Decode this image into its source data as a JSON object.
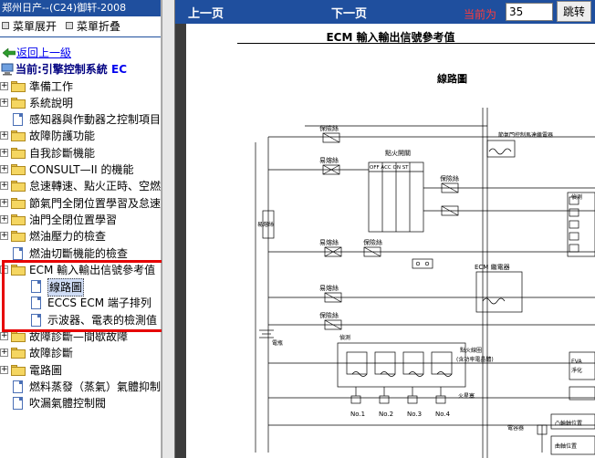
{
  "sidebar": {
    "title": "郑州日产--(C24)御轩-2008",
    "expand_all_label": "菜單展开",
    "collapse_all_label": "菜單折叠",
    "back_link": "返回上一級",
    "current_prefix": "当前:引擎控制系統",
    "current_suffix": "EC",
    "items": [
      {
        "label": "準備工作",
        "type": "folder",
        "expandable": true
      },
      {
        "label": "系統說明",
        "type": "folder",
        "expandable": true
      },
      {
        "label": "感知器與作動器之控制項目",
        "type": "doc",
        "expandable": false
      },
      {
        "label": "故障防護功能",
        "type": "folder",
        "expandable": true
      },
      {
        "label": "自我診斷機能",
        "type": "folder",
        "expandable": true
      },
      {
        "label": "CONSULT—II 的機能",
        "type": "folder",
        "expandable": true
      },
      {
        "label": "怠速轉速、點火正時、空燃",
        "type": "folder",
        "expandable": true
      },
      {
        "label": "節氣門全閉位置學習及怠速",
        "type": "folder",
        "expandable": true
      },
      {
        "label": "油門全閉位置學習",
        "type": "folder",
        "expandable": true
      },
      {
        "label": "燃油壓力的檢查",
        "type": "folder",
        "expandable": true
      },
      {
        "label": "燃油切斷機能的檢查",
        "type": "doc",
        "expandable": false
      },
      {
        "label": "ECM 輸入輸出信號參考值",
        "type": "folder-open",
        "expandable": true
      },
      {
        "label": "線路圖",
        "type": "doc",
        "child": true,
        "selected": true
      },
      {
        "label": "ECCS ECM 端子排列",
        "type": "doc",
        "child": true
      },
      {
        "label": "示波器、電表的檢測值",
        "type": "doc",
        "child": true
      },
      {
        "label": "故障診斷—間歇故障",
        "type": "folder",
        "expandable": true
      },
      {
        "label": "故障診斷",
        "type": "folder",
        "expandable": true
      },
      {
        "label": "電路圖",
        "type": "folder",
        "expandable": true
      },
      {
        "label": "燃料蒸發（蒸氣）氣體抑制",
        "type": "doc",
        "expandable": false
      },
      {
        "label": "吹漏氣體控制閥",
        "type": "doc",
        "expandable": false
      }
    ]
  },
  "toolbar": {
    "prev_label": "上一页",
    "next_label": "下一页",
    "current_page_label": "当前为",
    "page_value": "35",
    "go_label": "跳转"
  },
  "document": {
    "page_title": "ECM 輸入輸出信號參考值",
    "diagram_title": "線路圖",
    "labels": {
      "fuse": "保險絲",
      "fusible_link": "易熔絲",
      "ignition_switch": "點火開關",
      "switch_positions": [
        "OFF",
        "ACC",
        "ON",
        "ST"
      ],
      "main_relay": "ECM 繼電器",
      "throttle_motor_relay": "節氣門控制馬達繼電器",
      "battery": "電瓶",
      "injector_resistor": "燃料噴射器",
      "ignition_coil": "點火線圈（含功率電晶體）",
      "spark_plug": "火星塞",
      "condenser": "電容器",
      "detection": "偵測",
      "cylinders": [
        "No.1",
        "No.2",
        "No.3",
        "No.4"
      ],
      "right_labels": [
        "偵測",
        "EVA",
        "淨化",
        "凸輪軸位置",
        "曲軸位置"
      ]
    }
  }
}
